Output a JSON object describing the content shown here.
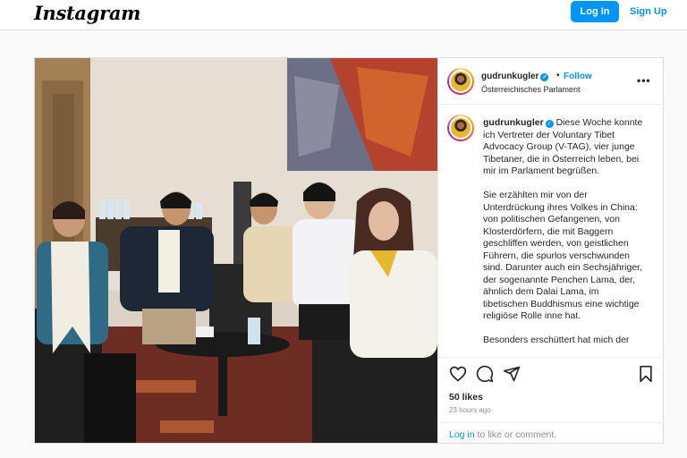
{
  "topbar": {
    "logo": "Instagram",
    "login_label": "Log In",
    "signup_label": "Sign Up"
  },
  "post": {
    "username": "gudrunkugler",
    "dot": "•",
    "follow_label": "Follow",
    "location": "Österreichisches Parlament",
    "more": "•••",
    "caption_paragraphs": [
      "Diese Woche konnte ich Vertreter der Voluntary Tibet Advocacy Group (V-TAG), vier junge Tibetaner, die in Österreich leben, bei mir im Parlament begrüßen.",
      "Sie erzählten mir von der Unterdrückung ihres Volkes in China: von politischen Gefangenen, von Klosterdörfern, die mit Baggern geschliffen werden, von geistlichen Führern, die spurlos verschwunden sind. Darunter auch ein Sechsjähriger, der sogenannte Penchen Lama, der, ähnlich dem Dalai Lama, im tibetischen Buddhismus eine wichtige religiöse Rolle inne hat.",
      "Besonders erschüttert hat mich der"
    ],
    "likes": "50 likes",
    "time_ago": "23 hours ago",
    "login_link": "Log in",
    "login_suffix": " to like or comment."
  },
  "icons": {
    "like": "heart-icon",
    "comment": "comment-icon",
    "share": "paper-plane-icon",
    "save": "bookmark-icon",
    "verified": "verified-badge-icon"
  },
  "colors": {
    "accent": "#0095f6",
    "text": "#262626",
    "muted": "#8e8e8e"
  }
}
